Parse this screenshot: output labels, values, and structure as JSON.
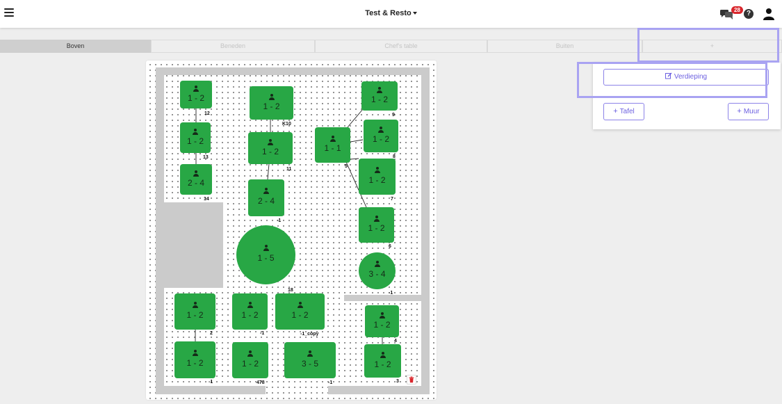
{
  "header": {
    "menu_icon": "hamburger-icon",
    "title": "Test & Resto",
    "chat_icon": "chat-bubbles-icon",
    "notification_count": "28",
    "help_icon": "question-circle-icon",
    "help_glyph": "?",
    "user_icon": "user-icon"
  },
  "tabs": [
    {
      "label": "Boven",
      "active": true
    },
    {
      "label": "Beneden",
      "active": false
    },
    {
      "label": "Chef's table",
      "active": false
    },
    {
      "label": "Buiten",
      "active": false
    },
    {
      "label": "+",
      "active": false
    }
  ],
  "panel": {
    "floor_button": "Verdieping",
    "floor_icon": "edit-icon",
    "table_button": "Tafel",
    "wall_button": "Muur",
    "plus_glyph": "+"
  },
  "tables": [
    {
      "id": "12",
      "capacity": "1 - 2"
    },
    {
      "id": "13",
      "capacity": "1 - 2"
    },
    {
      "id": "14",
      "capacity": "2 - 4"
    },
    {
      "id": "K10",
      "capacity": "1 - 2"
    },
    {
      "id": "11",
      "capacity": "1 - 2"
    },
    {
      "id": "-1",
      "capacity": "2 - 4"
    },
    {
      "id": "18",
      "capacity": "1 - 5"
    },
    {
      "id": "9",
      "capacity": "1 - 2"
    },
    {
      "id": "8",
      "capacity": "1 - 2"
    },
    {
      "id": "5",
      "capacity": "1 - 1"
    },
    {
      "id": "7",
      "capacity": "1 - 2"
    },
    {
      "id": "6",
      "capacity": "1 - 2"
    },
    {
      "id": "-1",
      "capacity": "3 - 4"
    },
    {
      "id": "2",
      "capacity": "1 - 2"
    },
    {
      "id": "-1",
      "capacity": "1 - 2"
    },
    {
      "id": "-1_copy",
      "capacity": "1 - 2"
    },
    {
      "id": "4",
      "capacity": "1 - 2"
    },
    {
      "id": "-1",
      "capacity": "1 - 2"
    },
    {
      "id": "478",
      "capacity": "1 - 2"
    },
    {
      "id": "-1",
      "capacity": "3 - 5"
    },
    {
      "id": "3",
      "capacity": "1 - 2"
    }
  ],
  "colors": {
    "table": "#28a745",
    "accent": "#6b5fe0",
    "highlight": "#a9a3f2",
    "badge": "#d9262c",
    "wall": "#cbcbcb"
  },
  "canvas_icons": {
    "delete": "trash-icon"
  }
}
